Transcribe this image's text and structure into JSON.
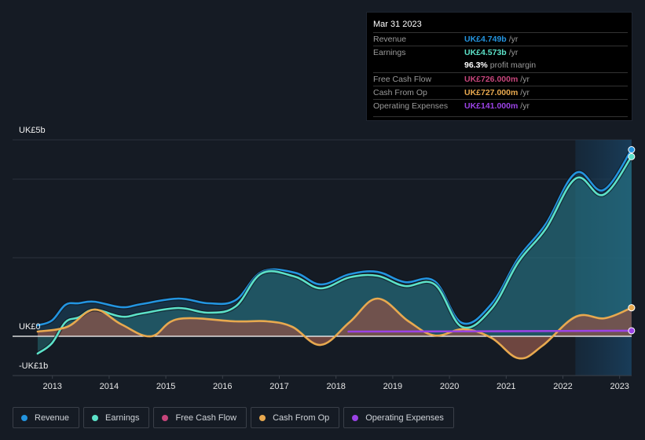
{
  "tooltip": {
    "date": "Mar 31 2023",
    "rows": [
      {
        "label": "Revenue",
        "value": "UK£4.749b",
        "unit": "/yr",
        "color": "#2394df"
      },
      {
        "label": "Earnings",
        "value": "UK£4.573b",
        "unit": "/yr",
        "color": "#5ce1c8"
      },
      {
        "label": "",
        "value": "96.3%",
        "unit": "profit margin",
        "color": "#ffffff"
      },
      {
        "label": "Free Cash Flow",
        "value": "UK£726.000m",
        "unit": "/yr",
        "color": "#c6457b"
      },
      {
        "label": "Cash From Op",
        "value": "UK£727.000m",
        "unit": "/yr",
        "color": "#e8a94f"
      },
      {
        "label": "Operating Expenses",
        "value": "UK£141.000m",
        "unit": "/yr",
        "color": "#9b43e6"
      }
    ]
  },
  "legend": [
    {
      "label": "Revenue",
      "color": "#2394df"
    },
    {
      "label": "Earnings",
      "color": "#5ce1c8"
    },
    {
      "label": "Free Cash Flow",
      "color": "#c6457b"
    },
    {
      "label": "Cash From Op",
      "color": "#e8a94f"
    },
    {
      "label": "Operating Expenses",
      "color": "#9b43e6"
    }
  ],
  "chart_data": {
    "type": "area",
    "title": "",
    "xlabel": "",
    "ylabel": "",
    "unit": "UK£ billions",
    "ylim": [
      -1,
      5
    ],
    "xlim": [
      2012.74,
      2023.21
    ],
    "y_tick_labels": [
      {
        "value": 5,
        "label": "UK£5b"
      },
      {
        "value": 0,
        "label": "UK£0"
      },
      {
        "value": -1,
        "label": "-UK£1b"
      }
    ],
    "gridlines": [
      5,
      4,
      2,
      0
    ],
    "x_ticks": [
      2013,
      2014,
      2015,
      2016,
      2017,
      2018,
      2019,
      2020,
      2021,
      2022,
      2023
    ],
    "x_tick_labels": [
      "2013",
      "2014",
      "2015",
      "2016",
      "2017",
      "2018",
      "2019",
      "2020",
      "2021",
      "2022",
      "2023"
    ],
    "highlight_range": [
      2022.22,
      2023.21
    ],
    "legend_position": "bottom",
    "series": [
      {
        "name": "Revenue",
        "color": "#2394df",
        "x": [
          2012.74,
          2012.99,
          2013.23,
          2013.46,
          2013.74,
          2014.22,
          2014.57,
          2015.22,
          2015.75,
          2016.23,
          2016.69,
          2017.27,
          2017.73,
          2018.24,
          2018.73,
          2019.21,
          2019.74,
          2020.22,
          2020.74,
          2021.22,
          2021.7,
          2022.23,
          2022.71,
          2023.21
        ],
        "values": [
          0.28,
          0.4,
          0.8,
          0.84,
          0.88,
          0.74,
          0.82,
          0.96,
          0.84,
          0.92,
          1.64,
          1.62,
          1.32,
          1.58,
          1.64,
          1.38,
          1.4,
          0.34,
          0.82,
          2.0,
          2.86,
          4.16,
          3.72,
          4.749
        ]
      },
      {
        "name": "Earnings",
        "color": "#5ce1c8",
        "x": [
          2012.74,
          2012.99,
          2013.23,
          2013.46,
          2013.74,
          2014.22,
          2014.57,
          2015.22,
          2015.75,
          2016.23,
          2016.69,
          2017.27,
          2017.73,
          2018.24,
          2018.73,
          2019.21,
          2019.74,
          2020.22,
          2020.74,
          2021.22,
          2021.7,
          2022.23,
          2022.71,
          2023.21
        ],
        "values": [
          -0.44,
          -0.18,
          0.36,
          0.48,
          0.68,
          0.5,
          0.58,
          0.72,
          0.6,
          0.76,
          1.6,
          1.52,
          1.22,
          1.5,
          1.54,
          1.28,
          1.32,
          0.24,
          0.7,
          1.9,
          2.74,
          4.02,
          3.6,
          4.573
        ]
      },
      {
        "name": "Free Cash Flow",
        "color": "#c6457b",
        "x": [
          2012.74,
          2013.26,
          2013.74,
          2014.22,
          2014.74,
          2015.22,
          2016.23,
          2016.79,
          2017.23,
          2017.73,
          2018.24,
          2018.73,
          2019.28,
          2019.74,
          2020.25,
          2020.74,
          2021.22,
          2021.64,
          2022.23,
          2022.74,
          2023.21
        ],
        "values": [
          0.12,
          0.24,
          0.68,
          0.3,
          0.0,
          0.44,
          0.38,
          0.38,
          0.24,
          -0.22,
          0.36,
          0.96,
          0.38,
          0.02,
          0.18,
          -0.04,
          -0.56,
          -0.24,
          0.5,
          0.46,
          0.726
        ]
      },
      {
        "name": "Cash From Op",
        "color": "#e8a94f",
        "x": [
          2012.74,
          2013.26,
          2013.74,
          2014.22,
          2014.74,
          2015.22,
          2016.23,
          2016.79,
          2017.23,
          2017.73,
          2018.24,
          2018.73,
          2019.28,
          2019.74,
          2020.25,
          2020.74,
          2021.22,
          2021.64,
          2022.23,
          2022.74,
          2023.21
        ],
        "values": [
          0.12,
          0.24,
          0.68,
          0.3,
          0.0,
          0.44,
          0.38,
          0.38,
          0.24,
          -0.22,
          0.36,
          0.96,
          0.38,
          0.02,
          0.18,
          -0.04,
          -0.56,
          -0.24,
          0.5,
          0.46,
          0.727
        ]
      },
      {
        "name": "Operating Expenses",
        "color": "#9b43e6",
        "x": [
          2018.22,
          2020.0,
          2022.0,
          2023.21
        ],
        "values": [
          0.12,
          0.125,
          0.135,
          0.141
        ]
      }
    ]
  }
}
